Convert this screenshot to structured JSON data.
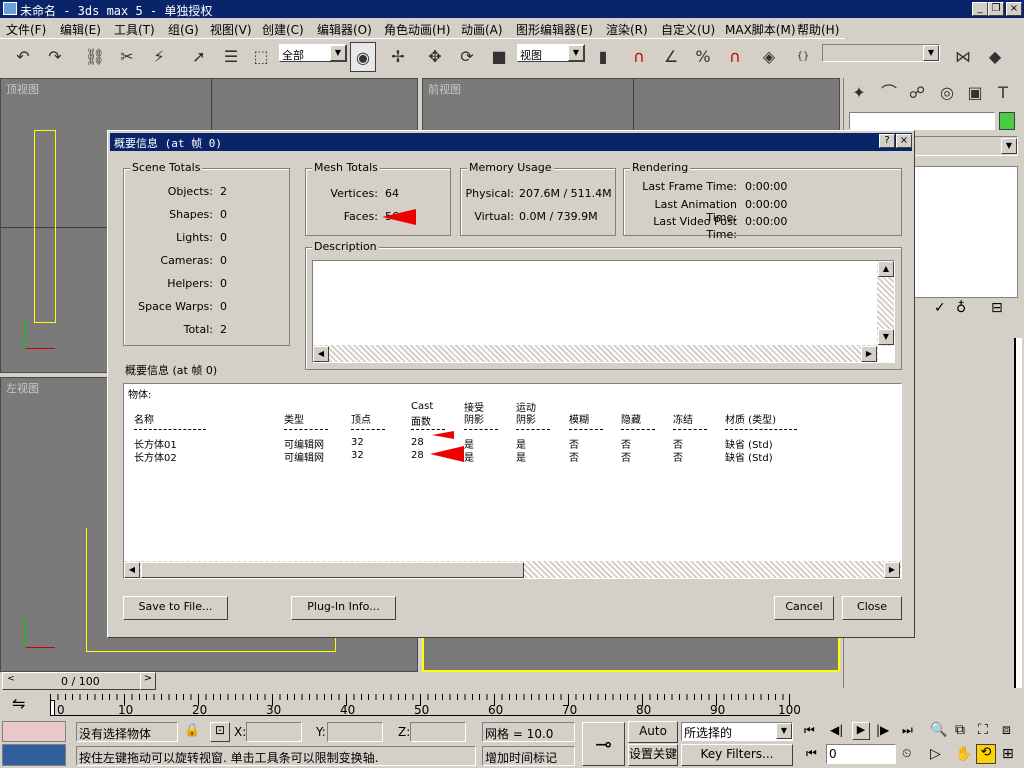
{
  "window": {
    "title": "未命名 - 3ds max 5 - 单独授权"
  },
  "menu": [
    "文件(F)",
    "编辑(E)",
    "工具(T)",
    "组(G)",
    "视图(V)",
    "创建(C)",
    "编辑器(O)",
    "角色动画(H)",
    "动画(A)",
    "图形编辑器(E)",
    "渲染(R)",
    "自定义(U)",
    "MAX脚本(M)",
    "帮助(H)"
  ],
  "toolbar": {
    "selection_filter": "全部",
    "reference_coord": "视图"
  },
  "viewports": {
    "top": "顶视图",
    "front": "前视图",
    "left": "左视图"
  },
  "dialog": {
    "title": "概要信息 (at 帧 0)",
    "help_btn": "?",
    "close_btn": "×",
    "scene_totals": {
      "title": "Scene Totals",
      "rows": [
        {
          "label": "Objects:",
          "value": "2"
        },
        {
          "label": "Shapes:",
          "value": "0"
        },
        {
          "label": "Lights:",
          "value": "0"
        },
        {
          "label": "Cameras:",
          "value": "0"
        },
        {
          "label": "Helpers:",
          "value": "0"
        },
        {
          "label": "Space Warps:",
          "value": "0"
        },
        {
          "label": "Total:",
          "value": "2"
        }
      ]
    },
    "mesh_totals": {
      "title": "Mesh Totals",
      "vertices_label": "Vertices:",
      "vertices": "64",
      "faces_label": "Faces:",
      "faces": "56"
    },
    "memory": {
      "title": "Memory Usage",
      "physical_label": "Physical:",
      "physical": "207.6M / 511.4M",
      "virtual_label": "Virtual:",
      "virtual": "0.0M / 739.9M"
    },
    "rendering": {
      "title": "Rendering",
      "rows": [
        {
          "label": "Last Frame Time:",
          "value": "0:00:00"
        },
        {
          "label": "Last Animation Time:",
          "value": "0:00:00"
        },
        {
          "label": "Last Video Post Time:",
          "value": "0:00:00"
        }
      ]
    },
    "description": {
      "title": "Description"
    },
    "summary_label": "概要信息 (at 帧 0)",
    "table": {
      "section": "物体:",
      "headers": [
        {
          "line1": "",
          "line2": "名称"
        },
        {
          "line1": "",
          "line2": "类型"
        },
        {
          "line1": "",
          "line2": "顶点"
        },
        {
          "line1": "Cast",
          "line2": "面数"
        },
        {
          "line1": "接受",
          "line2": "阴影"
        },
        {
          "line1": "运动",
          "line2": "阴影"
        },
        {
          "line1": "",
          "line2": "模糊"
        },
        {
          "line1": "",
          "line2": "隐藏"
        },
        {
          "line1": "",
          "line2": "冻结"
        },
        {
          "line1": "",
          "line2": "材质 (类型)"
        }
      ],
      "rows": [
        [
          "长方体01",
          "可编辑网",
          "32",
          "28",
          "是",
          "是",
          "否",
          "否",
          "否",
          "缺省 (Std)"
        ],
        [
          "长方体02",
          "可编辑网",
          "32",
          "28",
          "是",
          "是",
          "否",
          "否",
          "否",
          "缺省 (Std)"
        ]
      ]
    },
    "buttons": {
      "save": "Save to File...",
      "plugin": "Plug-In Info...",
      "cancel": "Cancel",
      "close": "Close"
    }
  },
  "timeline": {
    "frame": "0 / 100",
    "ticks": [
      "0",
      "10",
      "20",
      "30",
      "40",
      "50",
      "60",
      "70",
      "80",
      "90",
      "100"
    ]
  },
  "status": {
    "selection": "没有选择物体",
    "prompt": "按住左键拖动可以旋转视窗. 单击工具条可以限制变换轴.",
    "x_label": "X:",
    "y_label": "Y:",
    "z_label": "Z:",
    "grid": "网格 = 10.0",
    "add_time_tag": "增加时间标记",
    "auto_key": "Auto Key",
    "set_key": "设置关键帧",
    "key_mode": "所选择的",
    "key_filters": "Key Filters...",
    "frame_field": "0"
  },
  "colors": {
    "accent_red": "#ee0000",
    "title_blue": "#0a246a",
    "active_yellow": "#ffff00",
    "panel_green": "#4ccc44"
  }
}
